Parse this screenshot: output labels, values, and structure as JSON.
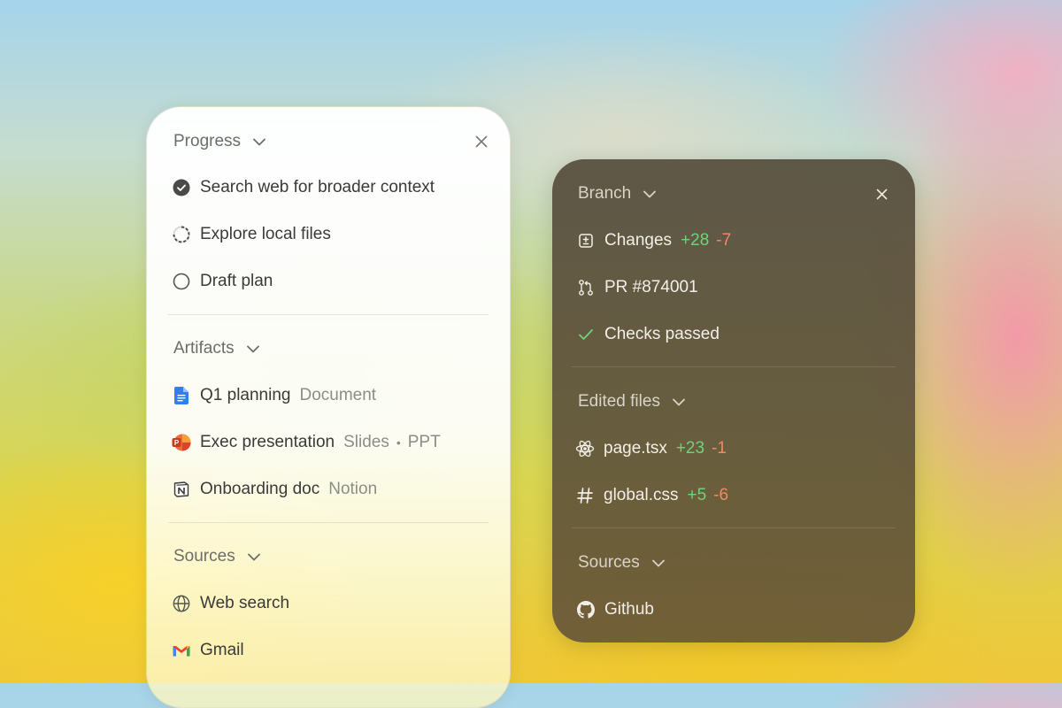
{
  "progress_panel": {
    "progress": {
      "title": "Progress",
      "tasks": [
        {
          "label": "Search web for broader context",
          "status": "done"
        },
        {
          "label": "Explore local files",
          "status": "in-progress"
        },
        {
          "label": "Draft plan",
          "status": "pending"
        }
      ]
    },
    "artifacts": {
      "title": "Artifacts",
      "items": [
        {
          "name": "Q1 planning",
          "type": "Document",
          "icon": "google-docs-icon"
        },
        {
          "name": "Exec presentation",
          "type": "Slides",
          "type2": "PPT",
          "icon": "powerpoint-icon"
        },
        {
          "name": "Onboarding doc",
          "type": "Notion",
          "icon": "notion-icon"
        }
      ]
    },
    "sources": {
      "title": "Sources",
      "items": [
        {
          "label": "Web search",
          "icon": "globe-icon"
        },
        {
          "label": "Gmail",
          "icon": "gmail-icon"
        }
      ]
    }
  },
  "branch_panel": {
    "branch": {
      "title": "Branch",
      "changes": {
        "label": "Changes",
        "added": "+28",
        "removed": "-7"
      },
      "pr": {
        "label": "PR #874001"
      },
      "checks": {
        "label": "Checks passed"
      }
    },
    "edited_files": {
      "title": "Edited files",
      "files": [
        {
          "name": "page.tsx",
          "added": "+23",
          "removed": "-1",
          "icon": "react-icon"
        },
        {
          "name": "global.css",
          "added": "+5",
          "removed": "-6",
          "icon": "hash-icon"
        }
      ]
    },
    "sources": {
      "title": "Sources",
      "items": [
        {
          "label": "Github",
          "icon": "github-icon"
        }
      ]
    }
  },
  "colors": {
    "added": "#6fd37a",
    "removed": "#f08a62",
    "dark_panel": "#574d3c",
    "docs_blue": "#2f7ff0",
    "check_green": "#6fd37a"
  }
}
